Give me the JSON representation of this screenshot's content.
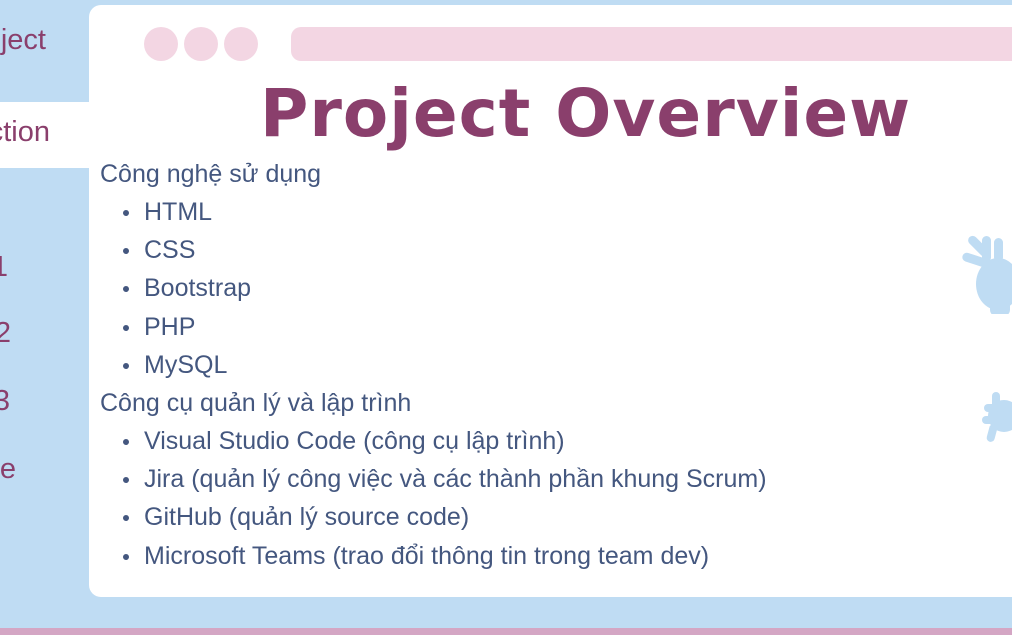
{
  "nav": {
    "items": [
      {
        "label": "ject"
      },
      {
        "label": "ction"
      },
      {
        "label": "1"
      },
      {
        "label": "2"
      },
      {
        "label": "3"
      },
      {
        "label": "e"
      }
    ]
  },
  "slide": {
    "title": "Project Overview",
    "groups": [
      {
        "heading": "Công nghệ sử dụng",
        "items": [
          "HTML",
          "CSS",
          "Bootstrap",
          "PHP",
          "MySQL"
        ]
      },
      {
        "heading": "Công cụ quản lý và lập trình",
        "items": [
          "Visual Studio Code (công cụ lập trình)",
          "Jira (quản lý công việc và các thành phần khung Scrum)",
          "GitHub (quản lý source code)",
          "Microsoft Teams (trao đổi thông tin trong team dev)"
        ]
      }
    ]
  },
  "colors": {
    "background": "#bfdcf3",
    "accent": "#8a3f6c",
    "window_chrome": "#f3d6e3",
    "body_text": "#44577f",
    "bottom_strip": "#d4a6c4"
  },
  "icons": {
    "decor_top": "hand-icon",
    "decor_bottom": "hand-icon"
  }
}
